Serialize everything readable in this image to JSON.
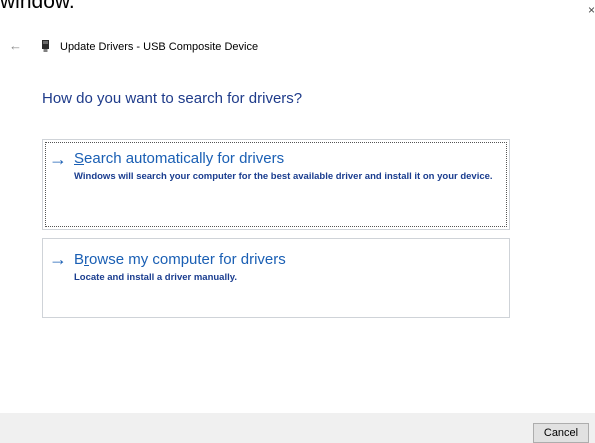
{
  "top_text": "window.",
  "window": {
    "title": "Update Drivers - USB Composite Device",
    "close_glyph": "×",
    "back_glyph": "←"
  },
  "heading": "How do you want to search for drivers?",
  "options": [
    {
      "arrow": "→",
      "title_accel": "S",
      "title_rest": "earch automatically for drivers",
      "description": "Windows will search your computer for the best available driver and install it on your device."
    },
    {
      "arrow": "→",
      "title_pre": "B",
      "title_accel": "r",
      "title_rest": "owse my computer for drivers",
      "description": "Locate and install a driver manually."
    }
  ],
  "footer": {
    "cancel_label": "Cancel"
  },
  "icons": {
    "back": "back-arrow-icon",
    "device": "usb-device-icon",
    "option_arrow": "arrow-right-icon",
    "close": "close-icon"
  },
  "colors": {
    "heading": "#1e3b8a",
    "link": "#1a5fb4",
    "footer_bg": "#f0f0f0"
  }
}
